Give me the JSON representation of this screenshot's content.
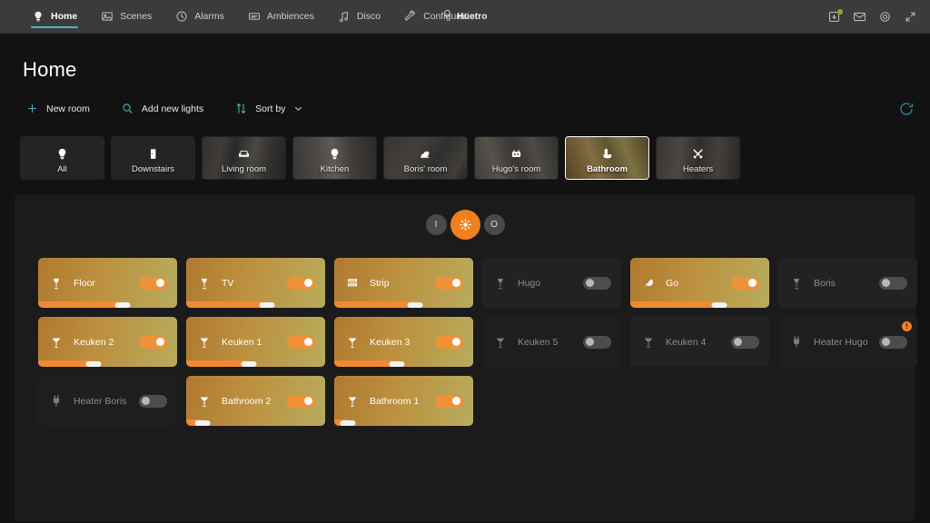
{
  "nav": {
    "items": [
      {
        "label": "Home",
        "icon": "bulb-icon",
        "active": true
      },
      {
        "label": "Scenes",
        "icon": "image-icon",
        "active": false
      },
      {
        "label": "Alarms",
        "icon": "clock-icon",
        "active": false
      },
      {
        "label": "Ambiences",
        "icon": "panorama-icon",
        "active": false
      },
      {
        "label": "Disco",
        "icon": "music-icon",
        "active": false
      },
      {
        "label": "Configuration",
        "icon": "wrench-icon",
        "active": false
      }
    ]
  },
  "brand": {
    "name": "Huetro",
    "icon": "bulb-icon"
  },
  "system_icons": [
    {
      "name": "update-icon",
      "badge": true,
      "badge_color": "#9dbb20"
    },
    {
      "name": "mail-icon",
      "badge": false
    },
    {
      "name": "gear-icon",
      "badge": false
    },
    {
      "name": "collapse-icon",
      "badge": false
    }
  ],
  "header": {
    "title": "Home"
  },
  "toolbar": {
    "new_room": "New room",
    "add_lights": "Add new lights",
    "sort_by": "Sort by",
    "refresh_icon": "refresh-icon",
    "accent": "#4fb3c4"
  },
  "rooms": [
    {
      "label": "All",
      "icon": "bulb-icon",
      "photo": "",
      "selected": false
    },
    {
      "label": "Downstairs",
      "icon": "door-icon",
      "photo": "",
      "selected": false
    },
    {
      "label": "Living room",
      "icon": "sofa-icon",
      "photo": "ph-living",
      "selected": false
    },
    {
      "label": "Kitchen",
      "icon": "bulb-icon",
      "photo": "ph-kitchen",
      "selected": false
    },
    {
      "label": "Boris' room",
      "icon": "horse-icon",
      "photo": "ph-boris",
      "selected": false
    },
    {
      "label": "Hugo's room",
      "icon": "robot-icon",
      "photo": "ph-hugo",
      "selected": false
    },
    {
      "label": "Bathroom",
      "icon": "bath-icon",
      "photo": "ph-bath",
      "selected": true
    },
    {
      "label": "Heaters",
      "icon": "tools-icon",
      "photo": "ph-heaters",
      "selected": false
    }
  ],
  "power": {
    "on_label": "I",
    "off_label": "O",
    "brightness_icon": "sun-icon",
    "active": "brightness",
    "active_color": "#f0801f"
  },
  "lights": [
    {
      "name": "Floor",
      "icon": "floor-lamp-icon",
      "on": true,
      "brightness": 61,
      "warning": false
    },
    {
      "name": "TV",
      "icon": "floor-lamp-icon",
      "on": true,
      "brightness": 58,
      "warning": false
    },
    {
      "name": "Strip",
      "icon": "lightstrip-icon",
      "on": true,
      "brightness": 58,
      "warning": false
    },
    {
      "name": "Hugo",
      "icon": "floor-lamp-icon",
      "on": false,
      "brightness": 0,
      "warning": false
    },
    {
      "name": "Go",
      "icon": "go-lamp-icon",
      "on": true,
      "brightness": 64,
      "warning": false
    },
    {
      "name": "Boris",
      "icon": "floor-lamp-icon",
      "on": false,
      "brightness": 0,
      "warning": false
    },
    {
      "name": "Keuken 2",
      "icon": "spot-icon",
      "on": true,
      "brightness": 40,
      "warning": false
    },
    {
      "name": "Keuken 1",
      "icon": "spot-icon",
      "on": true,
      "brightness": 45,
      "warning": false
    },
    {
      "name": "Keuken 3",
      "icon": "spot-icon",
      "on": true,
      "brightness": 45,
      "warning": false
    },
    {
      "name": "Keuken 5",
      "icon": "spot-icon",
      "on": false,
      "brightness": 0,
      "warning": false
    },
    {
      "name": "Keuken 4",
      "icon": "spot-icon",
      "on": false,
      "brightness": 0,
      "warning": false
    },
    {
      "name": "Heater Hugo",
      "icon": "plug-icon",
      "on": false,
      "brightness": 0,
      "warning": true
    },
    {
      "name": "Heater Boris",
      "icon": "plug-icon",
      "on": false,
      "brightness": 0,
      "warning": false
    },
    {
      "name": "Bathroom 2",
      "icon": "spot-icon",
      "on": true,
      "brightness": 12,
      "warning": false
    },
    {
      "name": "Bathroom 1",
      "icon": "spot-icon",
      "on": true,
      "brightness": 10,
      "warning": false
    }
  ],
  "colors": {
    "accent_teal": "#4fb3c4",
    "accent_orange": "#f0801f",
    "card_on_start": "#b07a30",
    "card_on_end": "#b8ab5c",
    "panel_bg": "#1b1b1b",
    "page_bg": "#121212",
    "topbar_bg": "#3b3b3b"
  }
}
